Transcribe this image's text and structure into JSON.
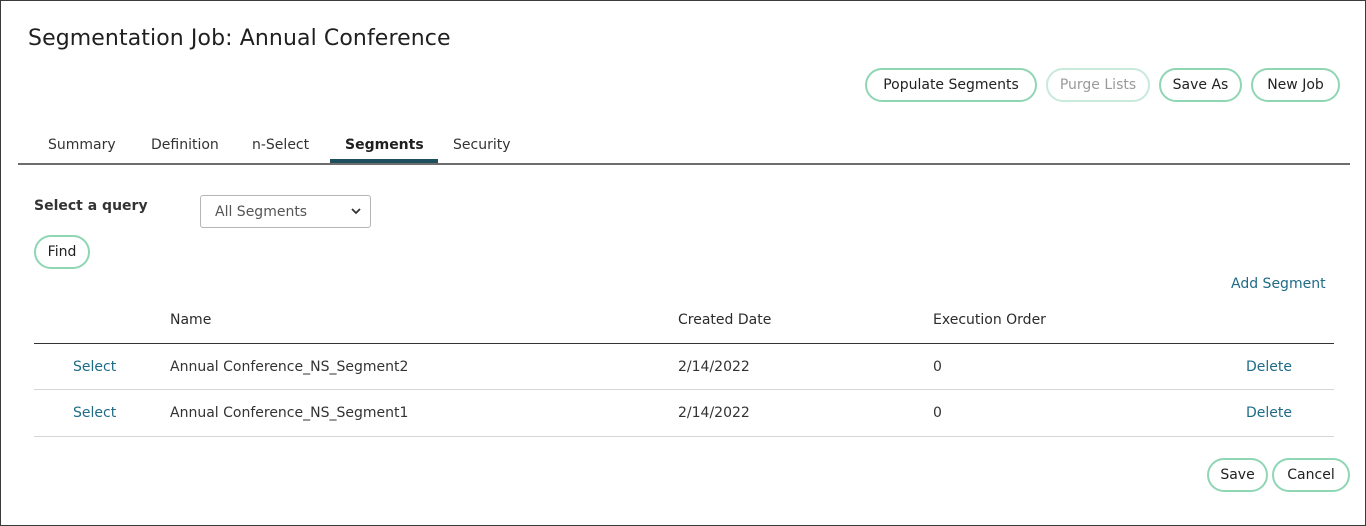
{
  "page": {
    "title": "Segmentation Job: Annual Conference"
  },
  "toolbar": {
    "populate_label": "Populate Segments",
    "purge_label": "Purge Lists",
    "save_as_label": "Save As",
    "new_job_label": "New Job"
  },
  "tabs": [
    {
      "label": "Summary",
      "active": false
    },
    {
      "label": "Definition",
      "active": false
    },
    {
      "label": "n-Select",
      "active": false
    },
    {
      "label": "Segments",
      "active": true
    },
    {
      "label": "Security",
      "active": false
    }
  ],
  "query": {
    "label": "Select a query",
    "selected": "All Segments",
    "find_label": "Find"
  },
  "add_segment_label": "Add Segment",
  "table": {
    "columns": [
      "Name",
      "Created Date",
      "Execution Order"
    ],
    "rows": [
      {
        "select": "Select",
        "name": "Annual Conference_NS_Segment2",
        "created": "2/14/2022",
        "order": "0",
        "delete": "Delete"
      },
      {
        "select": "Select",
        "name": "Annual Conference_NS_Segment1",
        "created": "2/14/2022",
        "order": "0",
        "delete": "Delete"
      }
    ]
  },
  "footer": {
    "save_label": "Save",
    "cancel_label": "Cancel"
  },
  "colors": {
    "pill_border": "#8fd6b5",
    "link": "#1f6b86",
    "tab_active": "#1f4f5e"
  }
}
